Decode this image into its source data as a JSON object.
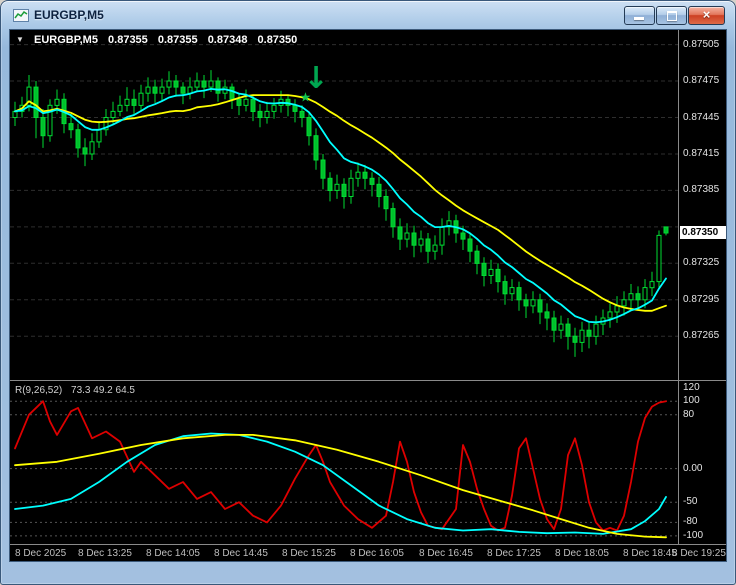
{
  "window": {
    "title": "EURGBP,M5",
    "buttons": [
      "minimize",
      "maximize",
      "close"
    ]
  },
  "chart_header": {
    "dropdown_icon": "▼",
    "symbol": "EURGBP,M5",
    "open": "0.87355",
    "high": "0.87355",
    "low": "0.87348",
    "close": "0.87350"
  },
  "indicator_label": {
    "name": "R(9,26,52)",
    "values": "73.3 49.2 64.5"
  },
  "price_axis": {
    "labels": [
      {
        "text": "0.87505",
        "value": 0.87505
      },
      {
        "text": "0.87475",
        "value": 0.87475
      },
      {
        "text": "0.87445",
        "value": 0.87445
      },
      {
        "text": "0.87415",
        "value": 0.87415
      },
      {
        "text": "0.87385",
        "value": 0.87385
      },
      {
        "text": "0.87325",
        "value": 0.87325
      },
      {
        "text": "0.87295",
        "value": 0.87295
      },
      {
        "text": "0.87265",
        "value": 0.87265
      }
    ],
    "current": {
      "text": "0.87350",
      "value": 0.8735
    }
  },
  "sub_axis": {
    "labels": [
      {
        "text": "120",
        "value": 120
      },
      {
        "text": "100",
        "value": 100
      },
      {
        "text": "80",
        "value": 80
      },
      {
        "text": "0.00",
        "value": 0
      },
      {
        "text": "-50",
        "value": -50
      },
      {
        "text": "-80",
        "value": -80
      },
      {
        "text": "-100",
        "value": -100
      }
    ]
  },
  "time_axis": {
    "labels": [
      "8 Dec 2025",
      "8 Dec 13:25",
      "8 Dec 14:05",
      "8 Dec 14:45",
      "8 Dec 15:25",
      "8 Dec 16:05",
      "8 Dec 16:45",
      "8 Dec 17:25",
      "8 Dec 18:05",
      "8 Dec 18:45",
      "8 Dec 19:25"
    ]
  },
  "colors": {
    "chart_bg": "#000000",
    "grid": "#2e2e2e",
    "candle_stroke": "#00dc32",
    "bull_fill": "#000000",
    "bear_fill": "#00c02c",
    "level": "#565656",
    "separator": "#8a8a8a",
    "axis_text": "#e4e4e4",
    "time_text": "#bfbfbf",
    "price_box_bg": "#ffffff",
    "price_box_text": "#000000",
    "signal_green": "#00a651"
  },
  "chart_data": {
    "type": "candlestick",
    "symbol": "EURGBP",
    "timeframe": "M5",
    "title": "EURGBP,M5",
    "current_ohlc": {
      "open": 0.87355,
      "high": 0.87355,
      "low": 0.87348,
      "close": 0.8735
    },
    "price_range": [
      0.87229,
      0.87517
    ],
    "grid_prices": [
      0.87505,
      0.87475,
      0.87445,
      0.87415,
      0.87385,
      0.87355,
      0.87325,
      0.87295,
      0.87265
    ],
    "candles": [
      [
        0.87445,
        0.87458,
        0.87438,
        0.8745
      ],
      [
        0.8745,
        0.87462,
        0.87445,
        0.87455
      ],
      [
        0.87455,
        0.8748,
        0.8745,
        0.8747
      ],
      [
        0.8747,
        0.87475,
        0.87428,
        0.87445
      ],
      [
        0.87445,
        0.87452,
        0.8742,
        0.8743
      ],
      [
        0.8743,
        0.8746,
        0.87425,
        0.87455
      ],
      [
        0.87455,
        0.87468,
        0.87448,
        0.8746
      ],
      [
        0.8746,
        0.87465,
        0.87432,
        0.8744
      ],
      [
        0.8744,
        0.87448,
        0.87428,
        0.87435
      ],
      [
        0.87435,
        0.8744,
        0.87412,
        0.8742
      ],
      [
        0.8742,
        0.87428,
        0.87405,
        0.87415
      ],
      [
        0.87415,
        0.87432,
        0.8741,
        0.87425
      ],
      [
        0.87425,
        0.87442,
        0.8742,
        0.87435
      ],
      [
        0.87435,
        0.87452,
        0.8743,
        0.87445
      ],
      [
        0.87445,
        0.87458,
        0.8744,
        0.8745
      ],
      [
        0.8745,
        0.87463,
        0.87446,
        0.87455
      ],
      [
        0.87455,
        0.8747,
        0.8745,
        0.8746
      ],
      [
        0.8746,
        0.87468,
        0.87448,
        0.87455
      ],
      [
        0.87455,
        0.87472,
        0.8745,
        0.87465
      ],
      [
        0.87465,
        0.87478,
        0.87458,
        0.8747
      ],
      [
        0.8747,
        0.87476,
        0.87457,
        0.87465
      ],
      [
        0.87465,
        0.87477,
        0.87458,
        0.8747
      ],
      [
        0.8747,
        0.87483,
        0.87464,
        0.87475
      ],
      [
        0.87475,
        0.8748,
        0.87462,
        0.8747
      ],
      [
        0.8747,
        0.87474,
        0.87456,
        0.87465
      ],
      [
        0.87465,
        0.87478,
        0.8746,
        0.8747
      ],
      [
        0.8747,
        0.87482,
        0.87466,
        0.87475
      ],
      [
        0.87475,
        0.8748,
        0.87461,
        0.8747
      ],
      [
        0.8747,
        0.87484,
        0.87466,
        0.87475
      ],
      [
        0.87475,
        0.87478,
        0.87458,
        0.87465
      ],
      [
        0.87465,
        0.87476,
        0.8746,
        0.8747
      ],
      [
        0.8747,
        0.87473,
        0.87452,
        0.8746
      ],
      [
        0.8746,
        0.87465,
        0.87447,
        0.87455
      ],
      [
        0.87455,
        0.87468,
        0.8745,
        0.8746
      ],
      [
        0.8746,
        0.87464,
        0.87442,
        0.8745
      ],
      [
        0.8745,
        0.87456,
        0.87437,
        0.87445
      ],
      [
        0.87445,
        0.87458,
        0.8744,
        0.8745
      ],
      [
        0.8745,
        0.87461,
        0.87444,
        0.87455
      ],
      [
        0.87455,
        0.87467,
        0.87449,
        0.8746
      ],
      [
        0.8746,
        0.87464,
        0.87446,
        0.87455
      ],
      [
        0.87455,
        0.8746,
        0.87441,
        0.8745
      ],
      [
        0.8745,
        0.87455,
        0.87437,
        0.87445
      ],
      [
        0.87445,
        0.8745,
        0.87422,
        0.8743
      ],
      [
        0.8743,
        0.87436,
        0.87402,
        0.8741
      ],
      [
        0.8741,
        0.87415,
        0.87386,
        0.87395
      ],
      [
        0.87395,
        0.874,
        0.87376,
        0.87385
      ],
      [
        0.87385,
        0.87398,
        0.87378,
        0.8739
      ],
      [
        0.8739,
        0.87395,
        0.8737,
        0.8738
      ],
      [
        0.8738,
        0.87402,
        0.87374,
        0.87395
      ],
      [
        0.87395,
        0.87408,
        0.87388,
        0.874
      ],
      [
        0.874,
        0.87406,
        0.87386,
        0.87395
      ],
      [
        0.87395,
        0.874,
        0.8738,
        0.8739
      ],
      [
        0.8739,
        0.87396,
        0.87371,
        0.8738
      ],
      [
        0.8738,
        0.87386,
        0.8736,
        0.8737
      ],
      [
        0.8737,
        0.87375,
        0.87346,
        0.87355
      ],
      [
        0.87355,
        0.87362,
        0.87336,
        0.87345
      ],
      [
        0.87345,
        0.87358,
        0.87338,
        0.8735
      ],
      [
        0.8735,
        0.87356,
        0.8733,
        0.8734
      ],
      [
        0.8734,
        0.87352,
        0.87334,
        0.87345
      ],
      [
        0.87345,
        0.8735,
        0.87325,
        0.87335
      ],
      [
        0.87335,
        0.87348,
        0.87328,
        0.8734
      ],
      [
        0.8734,
        0.87362,
        0.87332,
        0.87355
      ],
      [
        0.87355,
        0.87368,
        0.87348,
        0.8736
      ],
      [
        0.8736,
        0.87365,
        0.87342,
        0.8735
      ],
      [
        0.8735,
        0.87356,
        0.87336,
        0.87345
      ],
      [
        0.87345,
        0.8735,
        0.87326,
        0.87335
      ],
      [
        0.87335,
        0.8734,
        0.87316,
        0.87325
      ],
      [
        0.87325,
        0.8733,
        0.87306,
        0.87315
      ],
      [
        0.87315,
        0.87328,
        0.87308,
        0.8732
      ],
      [
        0.8732,
        0.87325,
        0.87301,
        0.8731
      ],
      [
        0.8731,
        0.87315,
        0.87291,
        0.873
      ],
      [
        0.873,
        0.87312,
        0.87294,
        0.87305
      ],
      [
        0.87305,
        0.8731,
        0.87286,
        0.87295
      ],
      [
        0.87295,
        0.873,
        0.8728,
        0.8729
      ],
      [
        0.8729,
        0.87302,
        0.87284,
        0.87295
      ],
      [
        0.87295,
        0.873,
        0.87275,
        0.87285
      ],
      [
        0.87285,
        0.87292,
        0.8727,
        0.8728
      ],
      [
        0.8728,
        0.87286,
        0.8726,
        0.8727
      ],
      [
        0.8727,
        0.87282,
        0.87263,
        0.87275
      ],
      [
        0.87275,
        0.8728,
        0.87254,
        0.87265
      ],
      [
        0.87265,
        0.87272,
        0.87248,
        0.8726
      ],
      [
        0.8726,
        0.87277,
        0.87252,
        0.8727
      ],
      [
        0.8727,
        0.87276,
        0.87255,
        0.87265
      ],
      [
        0.87265,
        0.87282,
        0.87258,
        0.87275
      ],
      [
        0.87275,
        0.87287,
        0.87266,
        0.8728
      ],
      [
        0.8728,
        0.87292,
        0.87272,
        0.87285
      ],
      [
        0.87285,
        0.87298,
        0.87276,
        0.8729
      ],
      [
        0.8729,
        0.87302,
        0.87282,
        0.87295
      ],
      [
        0.87295,
        0.87308,
        0.87288,
        0.873
      ],
      [
        0.873,
        0.87306,
        0.87286,
        0.87295
      ],
      [
        0.87295,
        0.87312,
        0.87288,
        0.87305
      ],
      [
        0.87305,
        0.87318,
        0.87298,
        0.8731
      ],
      [
        0.8731,
        0.87352,
        0.87304,
        0.87348
      ],
      [
        0.87355,
        0.87355,
        0.87348,
        0.8735
      ]
    ],
    "indicators": {
      "ma_fast": {
        "type": "EMA",
        "period": 10,
        "color": "#00ffff"
      },
      "ma_slow": {
        "type": "SMA",
        "period": 22,
        "color": "#ffff00"
      }
    },
    "markers": [
      {
        "shape": "arrow-down",
        "glyph": "↓",
        "index": 43,
        "value": 0.87477,
        "color": "#00a651",
        "size": 30
      },
      {
        "shape": "star",
        "glyph": "★",
        "index": 41.5,
        "value": 0.87461,
        "color": "#12c24e",
        "size": 13
      }
    ],
    "oscillator": {
      "name": "R(9,26,52)",
      "current_values": [
        73.3,
        49.2,
        64.5
      ],
      "range": [
        -112,
        130
      ],
      "levels": [
        100,
        80,
        0,
        -50,
        -80,
        -100
      ],
      "series": [
        {
          "name": "fast",
          "color": "#dd0000",
          "points": [
            [
              0,
              30
            ],
            [
              2,
              80
            ],
            [
              4,
              100
            ],
            [
              5,
              70
            ],
            [
              6,
              50
            ],
            [
              8,
              85
            ],
            [
              9,
              90
            ],
            [
              11,
              45
            ],
            [
              13,
              55
            ],
            [
              15,
              40
            ],
            [
              17,
              -5
            ],
            [
              18,
              10
            ],
            [
              20,
              -10
            ],
            [
              22,
              -30
            ],
            [
              24,
              -20
            ],
            [
              26,
              -45
            ],
            [
              28,
              -35
            ],
            [
              30,
              -60
            ],
            [
              32,
              -50
            ],
            [
              34,
              -70
            ],
            [
              36,
              -80
            ],
            [
              38,
              -55
            ],
            [
              40,
              -15
            ],
            [
              42,
              20
            ],
            [
              43,
              35
            ],
            [
              44,
              10
            ],
            [
              45,
              -20
            ],
            [
              47,
              -55
            ],
            [
              49,
              -75
            ],
            [
              51,
              -88
            ],
            [
              53,
              -70
            ],
            [
              54,
              -20
            ],
            [
              55,
              40
            ],
            [
              56,
              10
            ],
            [
              57,
              -35
            ],
            [
              58,
              -65
            ],
            [
              59,
              -85
            ],
            [
              61,
              -90
            ],
            [
              63,
              -60
            ],
            [
              64,
              35
            ],
            [
              65,
              10
            ],
            [
              66,
              -30
            ],
            [
              67,
              -60
            ],
            [
              68,
              -85
            ],
            [
              69,
              -92
            ],
            [
              70,
              -88
            ],
            [
              71,
              -40
            ],
            [
              72,
              30
            ],
            [
              73,
              45
            ],
            [
              74,
              0
            ],
            [
              75,
              -45
            ],
            [
              76,
              -75
            ],
            [
              77,
              -90
            ],
            [
              78,
              -60
            ],
            [
              79,
              20
            ],
            [
              80,
              45
            ],
            [
              81,
              5
            ],
            [
              82,
              -50
            ],
            [
              83,
              -80
            ],
            [
              84,
              -92
            ],
            [
              85,
              -88
            ],
            [
              86,
              -92
            ],
            [
              87,
              -70
            ],
            [
              88,
              -20
            ],
            [
              89,
              40
            ],
            [
              90,
              75
            ],
            [
              91,
              92
            ],
            [
              92,
              98
            ],
            [
              93,
              100
            ]
          ]
        },
        {
          "name": "mid",
          "color": "#00ffff",
          "points": [
            [
              0,
              -60
            ],
            [
              4,
              -55
            ],
            [
              8,
              -45
            ],
            [
              12,
              -20
            ],
            [
              16,
              10
            ],
            [
              20,
              35
            ],
            [
              24,
              48
            ],
            [
              28,
              52
            ],
            [
              32,
              50
            ],
            [
              36,
              40
            ],
            [
              40,
              25
            ],
            [
              44,
              5
            ],
            [
              48,
              -25
            ],
            [
              52,
              -55
            ],
            [
              56,
              -75
            ],
            [
              60,
              -88
            ],
            [
              64,
              -92
            ],
            [
              68,
              -90
            ],
            [
              72,
              -94
            ],
            [
              76,
              -96
            ],
            [
              80,
              -95
            ],
            [
              84,
              -97
            ],
            [
              88,
              -90
            ],
            [
              90,
              -78
            ],
            [
              92,
              -60
            ],
            [
              93,
              -42
            ]
          ]
        },
        {
          "name": "slow",
          "color": "#ffff00",
          "points": [
            [
              0,
              5
            ],
            [
              6,
              10
            ],
            [
              12,
              22
            ],
            [
              18,
              35
            ],
            [
              24,
              45
            ],
            [
              30,
              50
            ],
            [
              34,
              50
            ],
            [
              40,
              42
            ],
            [
              46,
              28
            ],
            [
              52,
              10
            ],
            [
              58,
              -10
            ],
            [
              64,
              -32
            ],
            [
              70,
              -50
            ],
            [
              74,
              -62
            ],
            [
              78,
              -75
            ],
            [
              82,
              -88
            ],
            [
              86,
              -97
            ],
            [
              90,
              -101
            ],
            [
              93,
              -102
            ]
          ]
        }
      ]
    }
  }
}
